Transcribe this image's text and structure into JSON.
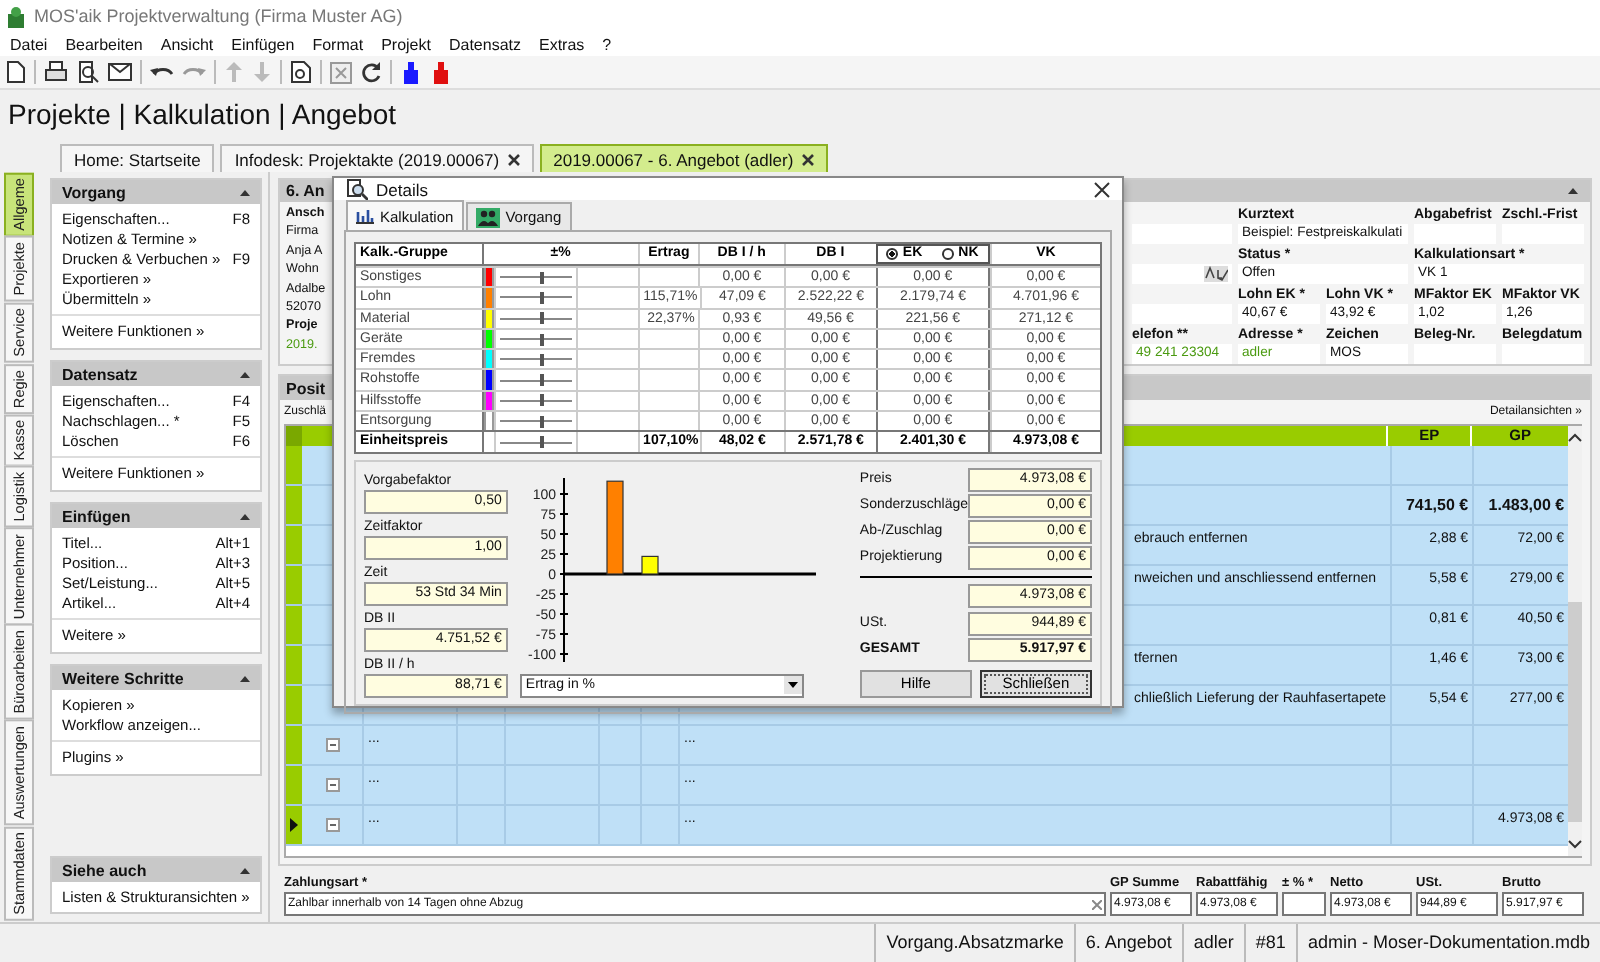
{
  "window": {
    "title": "MOS'aik Projektverwaltung (Firma Muster AG)"
  },
  "menu": [
    "Datei",
    "Bearbeiten",
    "Ansicht",
    "Einfügen",
    "Format",
    "Projekt",
    "Datensatz",
    "Extras",
    "?"
  ],
  "breadcrumb": "Projekte | Kalkulation | Angebot",
  "doc_tabs": [
    {
      "label": "Home: Startseite",
      "selected": false,
      "closable": false
    },
    {
      "label": "Infodesk: Projektakte (2019.00067)",
      "selected": false,
      "closable": true
    },
    {
      "label": "2019.00067 - 6. Angebot (adler)",
      "selected": true,
      "closable": true
    }
  ],
  "side_tabs": [
    {
      "label": "Allgeme",
      "selected": true
    },
    {
      "label": "Projekte",
      "selected": false
    },
    {
      "label": "Service",
      "selected": false
    },
    {
      "label": "Regie",
      "selected": false
    },
    {
      "label": "Kasse",
      "selected": false
    },
    {
      "label": "Logistik",
      "selected": false
    },
    {
      "label": "Unternehmer",
      "selected": false
    },
    {
      "label": "Büroarbeiten",
      "selected": false
    },
    {
      "label": "Auswertungen",
      "selected": false
    },
    {
      "label": "Stammdaten",
      "selected": false
    }
  ],
  "sidebar": [
    {
      "title": "Vorgang",
      "items": [
        {
          "label": "Eigenschaften...",
          "shortcut": "F8"
        },
        {
          "label": "Notizen & Termine »"
        },
        {
          "label": "Drucken & Verbuchen »",
          "shortcut": "F9"
        },
        {
          "label": "Exportieren »"
        },
        {
          "label": "Übermitteln »"
        }
      ],
      "more": "Weitere Funktionen »"
    },
    {
      "title": "Datensatz",
      "items": [
        {
          "label": "Eigenschaften...",
          "shortcut": "F4"
        },
        {
          "label": "Nachschlagen... *",
          "shortcut": "F5"
        },
        {
          "label": "Löschen",
          "shortcut": "F6"
        }
      ],
      "more": "Weitere Funktionen »"
    },
    {
      "title": "Einfügen",
      "items": [
        {
          "label": "Titel...",
          "shortcut": "Alt+1"
        },
        {
          "label": "Position...",
          "shortcut": "Alt+3"
        },
        {
          "label": "Set/Leistung...",
          "shortcut": "Alt+5"
        },
        {
          "label": "Artikel...",
          "shortcut": "Alt+4"
        }
      ],
      "more": "Weitere »"
    },
    {
      "title": "Weitere Schritte",
      "items": [
        {
          "label": "Kopieren »"
        },
        {
          "label": "Workflow anzeigen..."
        }
      ],
      "more": "Plugins »"
    },
    {
      "title": "Siehe auch",
      "items": [
        {
          "label": "Listen & Strukturansichten »"
        }
      ]
    }
  ],
  "header_card": {
    "title": "6. An",
    "left": [
      {
        "text": "Ansch",
        "kind": "label"
      },
      {
        "text": "Firma",
        "kind": "value"
      },
      {
        "text": "Anja A",
        "kind": "value"
      },
      {
        "text": "Wohn",
        "kind": "value"
      },
      {
        "text": "Adalbe",
        "kind": "value"
      },
      {
        "text": "52070",
        "kind": "value"
      },
      {
        "text": "Proje",
        "kind": "label"
      },
      {
        "text": "2019.",
        "kind": "link"
      }
    ],
    "fields": [
      [
        {
          "kind": "field",
          "wide": false
        },
        {
          "kind": "field",
          "label": "Kurztext",
          "value": "Beispiel: Festpreiskalkulati",
          "wide": true,
          "linked": false
        },
        {
          "kind": "field",
          "label": "Abgabefrist",
          "wide": false
        },
        {
          "kind": "field",
          "label": "Zschl.-Frist",
          "wide": false
        }
      ],
      [
        {
          "kind": "spellcheck",
          "wide": false
        },
        {
          "kind": "field",
          "label": "Status *",
          "value": "Offen",
          "wide": true,
          "linked": false
        },
        {
          "kind": "field",
          "label": "Kalkulationsart *",
          "value": "VK 1",
          "wide": true,
          "linked": false
        }
      ],
      [
        {
          "kind": "field",
          "wide": false
        },
        {
          "kind": "field",
          "label": "Lohn EK *",
          "value": "40,67 €",
          "wide": false,
          "linked": false
        },
        {
          "kind": "field",
          "label": "Lohn VK *",
          "value": "43,92 €",
          "wide": false,
          "linked": false
        },
        {
          "kind": "field",
          "label": "MFaktor EK",
          "value": "1,02",
          "wide": false,
          "linked": false
        },
        {
          "kind": "field",
          "label": "MFaktor VK",
          "value": "1,26",
          "wide": false,
          "linked": false
        }
      ],
      [
        {
          "kind": "field",
          "label": "elefon **",
          "value": "49 241 23304",
          "wide": false,
          "linked": true
        },
        {
          "kind": "field",
          "label": "Adresse *",
          "value": "adler",
          "wide": false,
          "linked": true
        },
        {
          "kind": "field",
          "label": "Zeichen",
          "value": "MOS",
          "wide": false,
          "linked": false
        },
        {
          "kind": "field",
          "label": "Beleg-Nr.",
          "wide": false
        },
        {
          "kind": "field",
          "label": "Belegdatum",
          "wide": false
        }
      ]
    ]
  },
  "positions": {
    "title": "Posit",
    "note": "Zuschlä",
    "link": "Detailansichten »",
    "columns": [
      "EP",
      "GP"
    ],
    "rows": [
      {
        "kind": "item",
        "bold": false,
        "current": false
      },
      {
        "kind": "item",
        "ep": "741,50 €",
        "gp": "1.483,00 €",
        "bold": true,
        "current": false
      },
      {
        "kind": "item",
        "text": "ebrauch entfernen",
        "ep": "2,88 €",
        "gp": "72,00 €",
        "bold": false,
        "current": false
      },
      {
        "kind": "item",
        "text": "nweichen und anschliessend entfernen",
        "ep": "5,58 €",
        "gp": "279,00 €",
        "bold": false,
        "current": false
      },
      {
        "kind": "item",
        "ep": "0,81 €",
        "gp": "40,50 €",
        "bold": false,
        "current": false
      },
      {
        "kind": "item",
        "text": "tfernen",
        "ep": "1,46 €",
        "gp": "73,00 €",
        "bold": false,
        "current": false
      },
      {
        "kind": "item",
        "text": "chließlich Lieferung der Rauhfasertapete",
        "ep": "5,54 €",
        "gp": "277,00 €",
        "bold": false,
        "current": false
      },
      {
        "kind": "group",
        "pos": "...",
        "text": "...",
        "bold": false,
        "current": false
      },
      {
        "kind": "group",
        "pos": "...",
        "text": "...",
        "bold": false,
        "current": false
      },
      {
        "kind": "group",
        "pos": "...",
        "text": "...",
        "gp": "4.973,08 €",
        "bold": false,
        "current": true
      }
    ]
  },
  "footer": {
    "payment_label": "Zahlungsart *",
    "payment_value": "Zahlbar innerhalb von 14 Tagen ohne Abzug",
    "totals": [
      {
        "label": "GP Summe",
        "value": "4.973,08 €"
      },
      {
        "label": "Rabattfähig",
        "value": "4.973,08 €"
      },
      {
        "label": "± % *"
      },
      {
        "label": "Netto",
        "value": "4.973,08 €"
      },
      {
        "label": "USt.",
        "value": "944,89 €"
      },
      {
        "label": "Brutto",
        "value": "5.917,97 €"
      }
    ]
  },
  "status_bar": [
    "Vorgang.Absatzmarke",
    "6. Angebot",
    "adler",
    "#81",
    "admin - Moser-Dokumentation.mdb"
  ],
  "dialog": {
    "title": "Details",
    "tabs": [
      {
        "label": "Kalkulation",
        "selected": true
      },
      {
        "label": "Vorgang",
        "selected": false
      }
    ],
    "columns": [
      "Kalk.-Gruppe",
      "±%",
      "Ertrag",
      "DB I / h",
      "DB I",
      "VK"
    ],
    "price_modes": [
      {
        "label": "EK",
        "selected": true
      },
      {
        "label": "NK",
        "selected": false
      }
    ],
    "rows": [
      {
        "kind": "group",
        "name": "Sonstiges",
        "color": "#ff0000",
        "level": 0.55,
        "db_h": "0,00 €",
        "db": "0,00 €",
        "price": "0,00 €",
        "vk": "0,00 €"
      },
      {
        "kind": "group",
        "name": "Lohn",
        "color": "#ff8000",
        "level": 0.55,
        "ertrag": "115,71%",
        "db_h": "47,09 €",
        "db": "2.522,22 €",
        "price": "2.179,74 €",
        "vk": "4.701,96 €"
      },
      {
        "kind": "group",
        "name": "Material",
        "color": "#ffff00",
        "level": 0.55,
        "ertrag": "22,37%",
        "db_h": "0,93 €",
        "db": "49,56 €",
        "price": "221,56 €",
        "vk": "271,12 €"
      },
      {
        "kind": "group",
        "name": "Geräte",
        "color": "#00ff00",
        "level": 0.55,
        "db_h": "0,00 €",
        "db": "0,00 €",
        "price": "0,00 €",
        "vk": "0,00 €"
      },
      {
        "kind": "group",
        "name": "Fremdes",
        "color": "#00ffff",
        "level": 0.55,
        "db_h": "0,00 €",
        "db": "0,00 €",
        "price": "0,00 €",
        "vk": "0,00 €"
      },
      {
        "kind": "group",
        "name": "Rohstoffe",
        "color": "#0000ff",
        "level": 0.55,
        "db_h": "0,00 €",
        "db": "0,00 €",
        "price": "0,00 €",
        "vk": "0,00 €"
      },
      {
        "kind": "group",
        "name": "Hilfsstoffe",
        "color": "#ff00ff",
        "level": 0.55,
        "db_h": "0,00 €",
        "db": "0,00 €",
        "price": "0,00 €",
        "vk": "0,00 €"
      },
      {
        "kind": "group",
        "name": "Entsorgung",
        "color": "#ffffff",
        "level": 0.55,
        "db_h": "0,00 €",
        "db": "0,00 €",
        "price": "0,00 €",
        "vk": "0,00 €"
      },
      {
        "kind": "total",
        "name": "Einheitspreis",
        "level": 0.55,
        "ertrag": "107,10%",
        "db_h": "48,02 €",
        "db": "2.571,78 €",
        "price": "2.401,30 €",
        "vk": "4.973,08 €"
      }
    ],
    "factors": [
      {
        "label": "Vorgabefaktor",
        "value": "0,50"
      },
      {
        "label": "Zeitfaktor",
        "value": "1,00"
      },
      {
        "label": "Zeit",
        "value": "53 Std 34 Min"
      },
      {
        "label": "DB II",
        "value": "4.751,52 €"
      },
      {
        "label": "DB II / h",
        "value": "88,71 €"
      }
    ],
    "chart_data": {
      "type": "bar",
      "series": [
        {
          "name": "Ertrag in %",
          "values": [
            0,
            116,
            22,
            0,
            0,
            0,
            0,
            0
          ]
        }
      ],
      "ylim": [
        -110,
        120
      ],
      "yticks": [
        100,
        75,
        50,
        25,
        0,
        -25,
        -50,
        -75,
        -100
      ]
    },
    "summary": [
      {
        "kind": "line",
        "label": "Preis",
        "value": "4.973,08 €"
      },
      {
        "kind": "line",
        "label": "Sonderzuschläge",
        "value": "0,00 €"
      },
      {
        "kind": "line",
        "label": "Ab-/Zuschlag",
        "value": "0,00 €"
      },
      {
        "kind": "line",
        "label": "Projektierung",
        "value": "0,00 €"
      },
      {
        "kind": "subtotal",
        "value": "4.973,08 €"
      },
      {
        "kind": "line",
        "label": "USt.",
        "value": "944,89 €"
      },
      {
        "kind": "total",
        "label": "GESAMT",
        "value": "5.917,97 €"
      }
    ],
    "buttons": [
      "Hilfe",
      "Schließen"
    ]
  }
}
